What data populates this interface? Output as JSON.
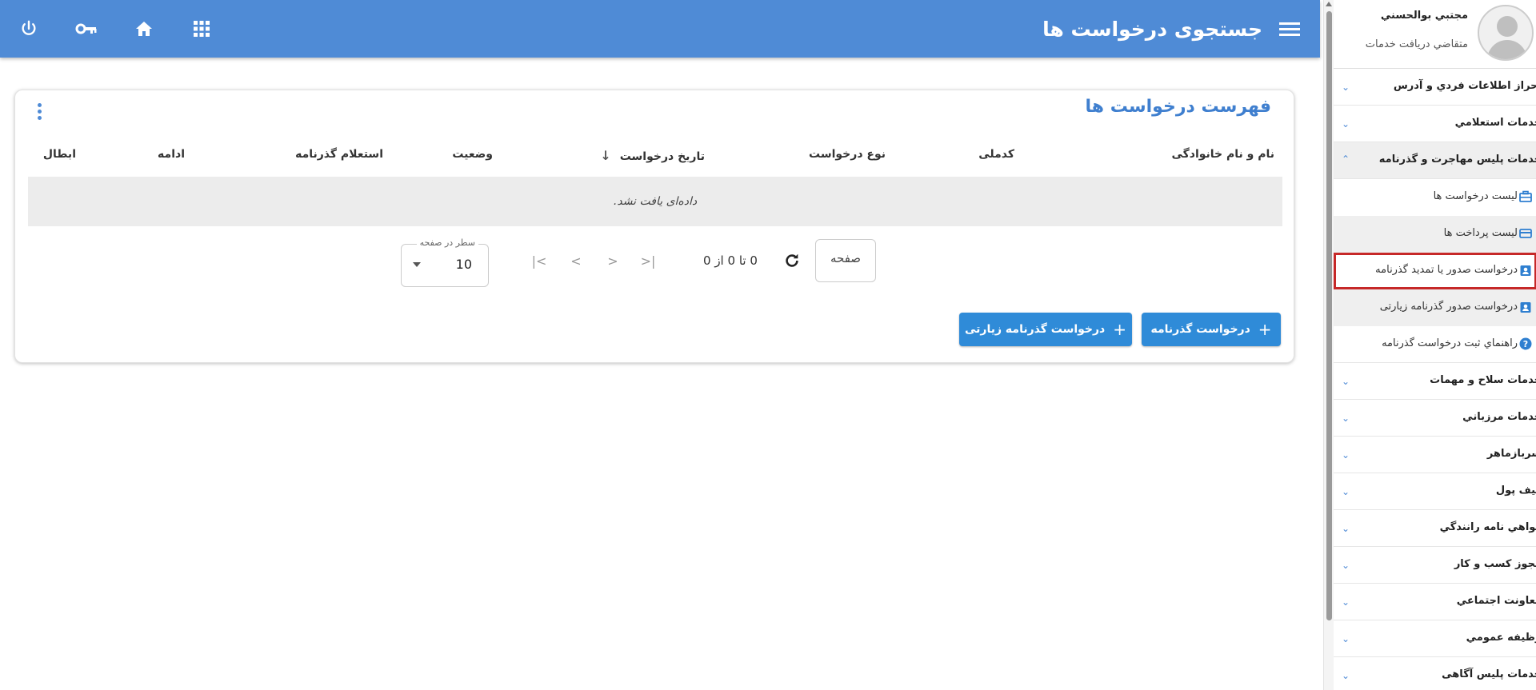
{
  "header": {
    "title": "جستجوی درخواست ها",
    "icons": [
      "power-icon",
      "key-icon",
      "home-icon",
      "apps-grid-icon"
    ]
  },
  "card": {
    "title": "فهرست درخواست ها",
    "columns": [
      "نام و نام خانوادگی",
      "کدملی",
      "نوع درخواست",
      "تاریخ درخواست",
      "وضعیت",
      "استعلام گذرنامه",
      "ادامه",
      "ابطال"
    ],
    "sort_arrow": "↓",
    "empty_message": "داده‌ای یافت نشد.",
    "pagination": {
      "page_label": "صفحه",
      "range_text": "0 تا 0 از 0",
      "rows_per_page_label": "سطر در صفحه",
      "rows_per_page_value": "10"
    },
    "buttons": {
      "passport_request": "درخواست گذرنامه",
      "pilgrim_passport_request": "درخواست گذرنامه زیارتی"
    }
  },
  "user": {
    "name": "مجتبي بوالحسني",
    "role": "متقاضي دريافت خدمات"
  },
  "sidebar": {
    "items": [
      {
        "label": "احراز اطلاعات فردي و آدرس"
      },
      {
        "label": "خدمات استعلامي"
      },
      {
        "label": "خدمات پليس مهاجرت و گذرنامه"
      },
      {
        "label": "خدمات سلاح و مهمات"
      },
      {
        "label": "خدمات مرزباني"
      },
      {
        "label": "سربازماهر"
      },
      {
        "label": "کیف پول"
      },
      {
        "label": "گواهي نامه رانندگي"
      },
      {
        "label": "مجوز کسب و کار"
      },
      {
        "label": "معاونت اجتماعي"
      },
      {
        "label": "وظيفه عمومي"
      },
      {
        "label": "خدمات پلیس آگاهی"
      }
    ],
    "subitems": [
      {
        "label": "ليست درخواست ها",
        "icon": "briefcase-icon"
      },
      {
        "label": "ليست پرداخت ها",
        "icon": "credit-card-icon"
      },
      {
        "label": "درخواست صدور يا تمديد گذرنامه",
        "icon": "badge-icon"
      },
      {
        "label": "درخواست صدور گذرنامه زیارتی",
        "icon": "badge-icon"
      },
      {
        "label": "راهنماي ثبت درخواست گذرنامه",
        "icon": "help-icon"
      }
    ]
  },
  "colors": {
    "header": "#4f8bd6",
    "button": "#2f8bd8",
    "highlight": "#c62828"
  }
}
